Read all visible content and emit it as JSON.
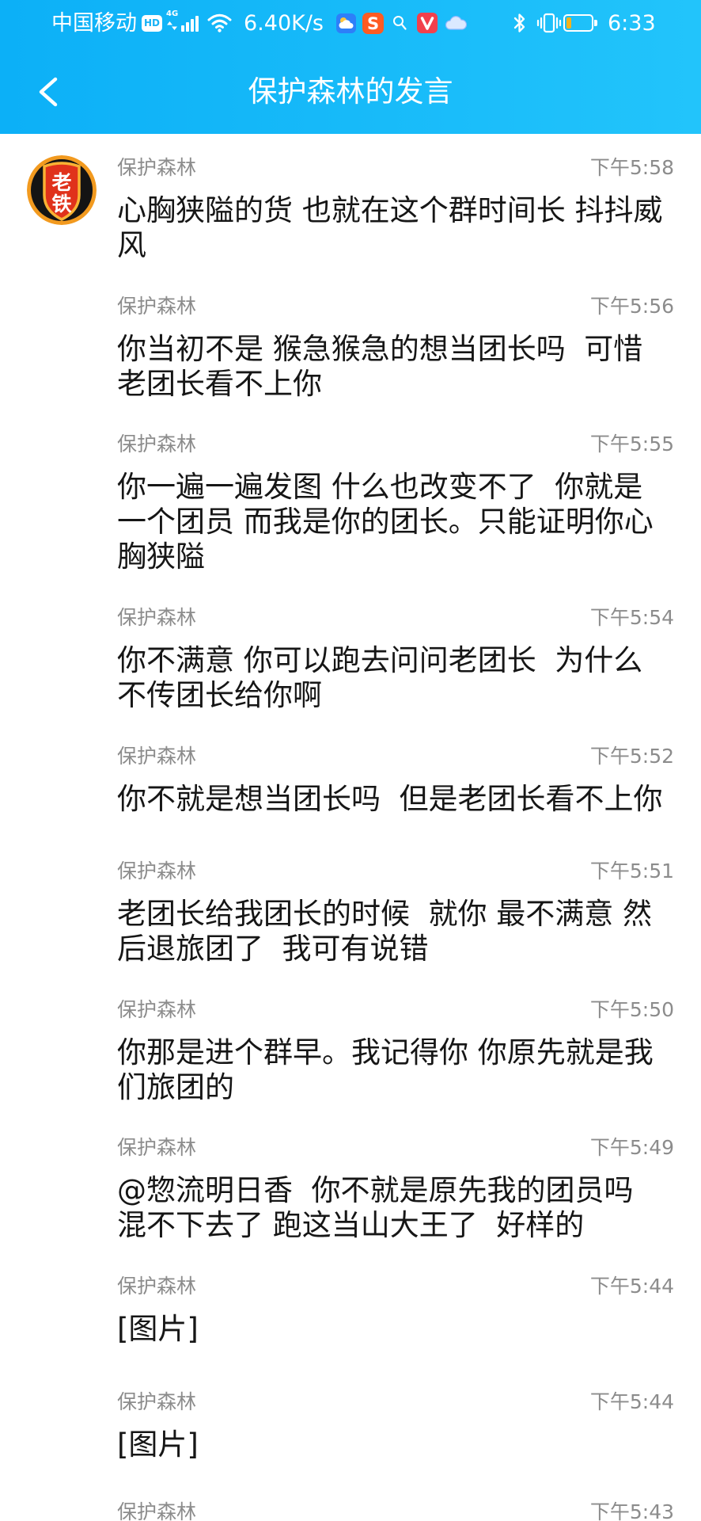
{
  "theme": {
    "header_gradient_start": "#0cb0f7",
    "header_gradient_end": "#22c4fb",
    "text_primary": "#161616",
    "text_secondary": "#8c8c8c",
    "background": "#ffffff"
  },
  "status_bar": {
    "carrier": "中国移动",
    "hd_badge": "HD",
    "network_type": "4G",
    "signal_icon": "cellular-signal-icon",
    "wifi_icon": "wifi-icon",
    "network_speed": "6.40K/s",
    "notification_icons": [
      {
        "icon": "weather-icon"
      },
      {
        "icon": "sogou-input-icon",
        "glyph": "S"
      },
      {
        "icon": "search-icon"
      },
      {
        "icon": "video-app-icon"
      },
      {
        "icon": "cloud-icon"
      }
    ],
    "bluetooth_icon": "bluetooth-icon",
    "vibrate_icon": "vibrate-icon",
    "battery": {
      "icon": "battery-icon",
      "level_percent": 20,
      "fill_color": "#f6b21b"
    },
    "time": "6:33"
  },
  "header": {
    "back_icon": "back-arrow-icon",
    "title": "保护森林的发言"
  },
  "avatar": {
    "icon": "user-avatar",
    "lettering": [
      "老",
      "铁"
    ]
  },
  "messages": [
    {
      "sender": "保护森林",
      "time": "下午5:58",
      "lines": [
        "心胸狭隘的货 也就在这个群时间长 抖抖威",
        "风"
      ]
    },
    {
      "sender": "保护森林",
      "time": "下午5:56",
      "lines": [
        "你当初不是 猴急猴急的想当团长吗  可惜",
        "老团长看不上你"
      ]
    },
    {
      "sender": "保护森林",
      "time": "下午5:55",
      "lines": [
        "你一遍一遍发图 什么也改变不了  你就是",
        "一个团员 而我是你的团长。只能证明你心",
        "胸狭隘"
      ]
    },
    {
      "sender": "保护森林",
      "time": "下午5:54",
      "lines": [
        "你不满意 你可以跑去问问老团长  为什么",
        "不传团长给你啊"
      ]
    },
    {
      "sender": "保护森林",
      "time": "下午5:52",
      "lines": [
        "你不就是想当团长吗  但是老团长看不上你"
      ]
    },
    {
      "sender": "保护森林",
      "time": "下午5:51",
      "lines": [
        "老团长给我团长的时候  就你 最不满意 然",
        "后退旅团了  我可有说错"
      ]
    },
    {
      "sender": "保护森林",
      "time": "下午5:50",
      "lines": [
        "你那是进个群早。我记得你 你原先就是我",
        "们旅团的"
      ]
    },
    {
      "sender": "保护森林",
      "time": "下午5:49",
      "lines": [
        "@惣流明日香  你不就是原先我的团员吗",
        "混不下去了 跑这当山大王了  好样的"
      ]
    },
    {
      "sender": "保护森林",
      "time": "下午5:44",
      "lines": [
        "[图片]"
      ]
    },
    {
      "sender": "保护森林",
      "time": "下午5:44",
      "lines": [
        "[图片]"
      ]
    },
    {
      "sender": "保护森林",
      "time": "下午5:43"
    }
  ]
}
